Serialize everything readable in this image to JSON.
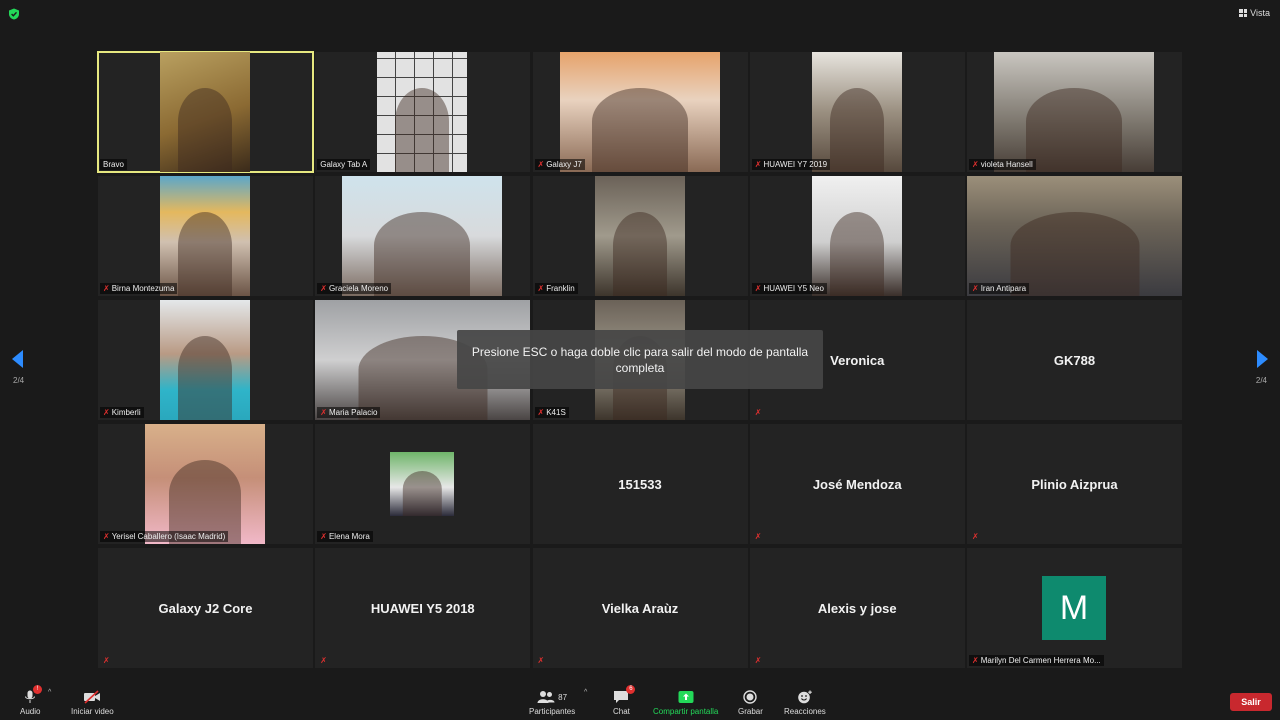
{
  "top": {
    "view_label": "Vista"
  },
  "tiles": [
    {
      "label": "Bravo",
      "muted": false,
      "video": "v-warm",
      "vx": 62,
      "vw": 90,
      "active": true
    },
    {
      "label": "Galaxy Tab A",
      "muted": false,
      "video": "v-tiles2",
      "vx": 62,
      "vw": 90
    },
    {
      "label": "Galaxy J7",
      "muted": true,
      "video": "v-peach",
      "vx": 27,
      "vw": 160
    },
    {
      "label": "HUAWEI Y7 2019",
      "muted": true,
      "video": "v-room",
      "vx": 62,
      "vw": 90
    },
    {
      "label": "violeta Hansell",
      "muted": true,
      "video": "v-light",
      "vx": 27,
      "vw": 160
    },
    {
      "label": "Birna Montezuma",
      "muted": true,
      "video": "v-colorful",
      "vx": 62,
      "vw": 90
    },
    {
      "label": "Graciela Moreno",
      "muted": true,
      "video": "v-wall",
      "vx": 27,
      "vw": 160
    },
    {
      "label": "Franklin",
      "muted": true,
      "video": "v-tin",
      "vx": 62,
      "vw": 90
    },
    {
      "label": "HUAWEI Y5 Neo",
      "muted": true,
      "video": "v-white",
      "vx": 62,
      "vw": 90
    },
    {
      "label": "Iran Antipara",
      "muted": true,
      "video": "v-plaid",
      "vx": 0,
      "vw": 215
    },
    {
      "label": "Kimberli",
      "muted": true,
      "video": "v-teal",
      "vx": 62,
      "vw": 90
    },
    {
      "label": "Maria Palacio",
      "muted": true,
      "video": "v-gray",
      "vx": 0,
      "vw": 215
    },
    {
      "label": "K41S",
      "muted": true,
      "video": "v-tin",
      "vx": 62,
      "vw": 90
    },
    {
      "label": "",
      "name": "Veronica",
      "muted": true
    },
    {
      "label": "",
      "name": "GK788",
      "muted": false
    },
    {
      "label": "Yerisel Caballero (Isaac Madrid)",
      "muted": true,
      "video": "v-pink",
      "vx": 47,
      "vw": 120
    },
    {
      "label": "Elena Mora",
      "muted": true,
      "video": "v-small",
      "vx": 75,
      "vw": 64,
      "small": true
    },
    {
      "label": "",
      "name": "151533",
      "muted": false
    },
    {
      "label": "",
      "name": "José Mendoza",
      "muted": true
    },
    {
      "label": "",
      "name": "Plinio Aizprua",
      "muted": true
    },
    {
      "label": "",
      "name": "Galaxy J2 Core",
      "muted": true
    },
    {
      "label": "",
      "name": "HUAWEI Y5 2018",
      "muted": true
    },
    {
      "label": "",
      "name": "Vielka Araùz",
      "muted": true
    },
    {
      "label": "",
      "name": "Alexis y jose",
      "muted": true
    },
    {
      "label": "Marilyn Del Carmen Herrera Mo...",
      "muted": true,
      "avatar": "M"
    }
  ],
  "toast": "Presione ESC o haga doble clic para salir del modo de pantalla completa",
  "pager": {
    "left": "2/4",
    "right": "2/4"
  },
  "toolbar": {
    "audio": "Audio",
    "audio_badge": "!",
    "video": "Iniciar video",
    "participants": "Participantes",
    "participants_count": "87",
    "chat": "Chat",
    "chat_badge": "6",
    "share": "Compartir pantalla",
    "record": "Grabar",
    "reactions": "Reacciones",
    "leave": "Salir"
  },
  "colors": {
    "accent": "#2d8cff",
    "share": "#23d959",
    "leave": "#c8282e",
    "active_border": "#e6e880",
    "mute": "#e0302f"
  }
}
